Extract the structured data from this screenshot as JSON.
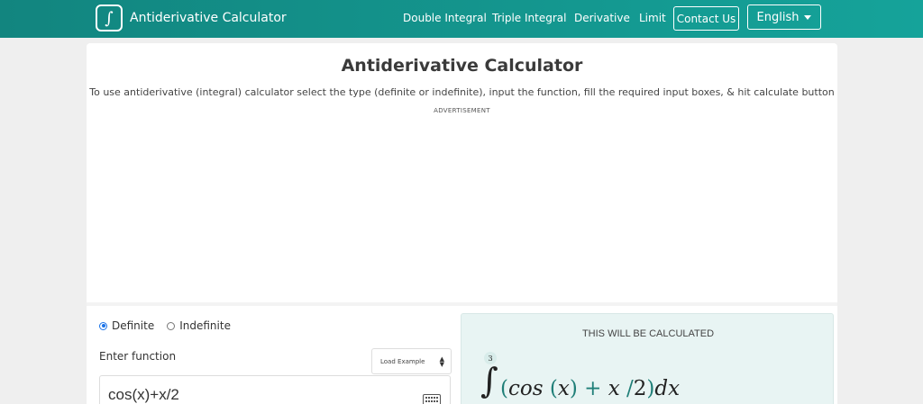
{
  "header": {
    "brand": {
      "logo_glyph": "∫",
      "name": "Antiderivative Calculator"
    },
    "nav": [
      {
        "label": "Double Integral"
      },
      {
        "label": "Triple Integral"
      },
      {
        "label": "Derivative"
      },
      {
        "label": "Limit"
      }
    ],
    "contact_label": "Contact Us",
    "language_label": "English",
    "accent_color": "#15a39a"
  },
  "main": {
    "title": "Antiderivative Calculator",
    "description": "To use antiderivative (integral) calculator select the type (definite or indefinite), input the function, fill the required input boxes, & hit calculate button",
    "ad_label": "ADVERTISEMENT"
  },
  "form": {
    "type_options": [
      {
        "label": "Definite",
        "checked": true
      },
      {
        "label": "Indefinite",
        "checked": false
      }
    ],
    "function_label": "Enter function",
    "load_example_label": "Load Example",
    "function_value": "cos(x)+x/2"
  },
  "preview": {
    "title": "THIS WILL BE CALCULATED",
    "upper_limit": "3",
    "integral_symbol": "∫",
    "expression": {
      "open": "(",
      "cos": "cos",
      "lparen": "(",
      "x1": "x",
      "rparen": ")",
      "plus": "+",
      "x2": "x",
      "slash": "/",
      "two": "2",
      "close": ")",
      "dx": "dx"
    }
  }
}
